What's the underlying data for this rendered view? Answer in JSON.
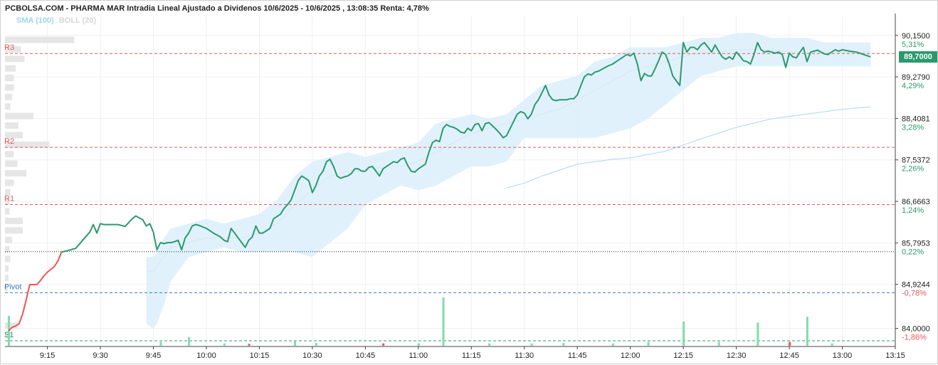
{
  "header": {
    "title": "PCBOLSA.COM - PHARMA MAR Intradia Lineal Ajustado a Dividenos 10/6/2025 - 10/6/2025 , 13:08:35 Renta: 4,78%",
    "legend_sma": "SMA (100)",
    "legend_boll": "BOLL (20)"
  },
  "last_price": "89,7000",
  "colors": {
    "up": "#2a9a6e",
    "down": "#ee5555",
    "band": "#ddeffb",
    "sma": "#a9d8f4",
    "pivot": "#3a78c8",
    "resistance": "#e05a5a",
    "support": "#2a9a6e",
    "volume_up": "#7fdcae"
  },
  "chart_data": {
    "type": "line",
    "ylim": [
      83.62,
      90.55
    ],
    "xlim": [
      "9:03",
      "13:15"
    ],
    "x_ticks": [
      "9:15",
      "9:30",
      "9:45",
      "10:00",
      "10:15",
      "10:30",
      "10:45",
      "11:00",
      "11:15",
      "11:30",
      "11:45",
      "12:00",
      "12:15",
      "12:30",
      "12:45",
      "13:00",
      "13:15"
    ],
    "y_ticks": [
      {
        "value": "90,1500",
        "pct": "5,31%"
      },
      {
        "value": "89,2790",
        "pct": "4,29%"
      },
      {
        "value": "88,4081",
        "pct": "3,28%"
      },
      {
        "value": "87,5372",
        "pct": "2,26%"
      },
      {
        "value": "86,6663",
        "pct": "1,24%"
      },
      {
        "value": "85,7953",
        "pct": "0,22%"
      },
      {
        "value": "84,9244",
        "pct": "-0,78%"
      },
      {
        "value": "84,0000",
        "pct": "-1,86%"
      }
    ],
    "reference_line": 85.61,
    "levels": [
      {
        "name": "R3",
        "value": 89.77
      },
      {
        "name": "R2",
        "value": 87.8
      },
      {
        "name": "R1",
        "value": 86.6
      },
      {
        "name": "Pivot",
        "value": 84.75
      },
      {
        "name": "S1",
        "value": 83.74
      }
    ],
    "price_red": [
      [
        "9:04",
        83.95
      ],
      [
        "9:05",
        84.02
      ],
      [
        "9:06",
        84.05
      ],
      [
        "9:07",
        84.1
      ],
      [
        "9:08",
        84.3
      ],
      [
        "9:09",
        84.6
      ],
      [
        "9:10",
        84.92
      ],
      [
        "9:11",
        84.92
      ],
      [
        "9:12",
        84.92
      ],
      [
        "9:13",
        85.0
      ],
      [
        "9:14",
        85.1
      ],
      [
        "9:15",
        85.18
      ],
      [
        "9:16",
        85.24
      ],
      [
        "9:17",
        85.3
      ],
      [
        "9:18",
        85.42
      ],
      [
        "9:19",
        85.6
      ]
    ],
    "price_green": [
      [
        "9:19",
        85.6
      ],
      [
        "9:21",
        85.64
      ],
      [
        "9:23",
        85.68
      ],
      [
        "9:25",
        85.85
      ],
      [
        "9:27",
        86.02
      ],
      [
        "9:28",
        86.18
      ],
      [
        "9:29",
        86.0
      ],
      [
        "9:30",
        86.2
      ],
      [
        "9:31",
        86.18
      ],
      [
        "9:33",
        86.18
      ],
      [
        "9:35",
        86.18
      ],
      [
        "9:37",
        86.14
      ],
      [
        "9:39",
        86.3
      ],
      [
        "9:40",
        86.36
      ],
      [
        "9:42",
        86.28
      ],
      [
        "9:43",
        86.15
      ],
      [
        "9:44",
        86.2
      ],
      [
        "9:45",
        86.02
      ],
      [
        "9:46",
        85.65
      ],
      [
        "9:47",
        85.8
      ],
      [
        "9:48",
        85.78
      ],
      [
        "9:49",
        85.8
      ],
      [
        "9:50",
        85.8
      ],
      [
        "9:51",
        85.82
      ],
      [
        "9:52",
        85.85
      ],
      [
        "9:53",
        85.65
      ],
      [
        "9:54",
        85.9
      ],
      [
        "9:55",
        86.0
      ],
      [
        "9:56",
        86.15
      ],
      [
        "9:57",
        86.18
      ],
      [
        "9:58",
        86.16
      ],
      [
        "10:00",
        86.1
      ],
      [
        "10:02",
        86.0
      ],
      [
        "10:04",
        85.92
      ],
      [
        "10:05",
        85.85
      ],
      [
        "10:06",
        85.82
      ],
      [
        "10:07",
        86.1
      ],
      [
        "10:08",
        86.0
      ],
      [
        "10:09",
        85.9
      ],
      [
        "10:10",
        85.8
      ],
      [
        "10:11",
        85.7
      ],
      [
        "10:12",
        85.85
      ],
      [
        "10:13",
        85.92
      ],
      [
        "10:14",
        86.15
      ],
      [
        "10:15",
        86.0
      ],
      [
        "10:16",
        86.0
      ],
      [
        "10:17",
        86.05
      ],
      [
        "10:18",
        86.1
      ],
      [
        "10:19",
        86.3
      ],
      [
        "10:20",
        86.35
      ],
      [
        "10:21",
        86.4
      ],
      [
        "10:22",
        86.52
      ],
      [
        "10:23",
        86.6
      ],
      [
        "10:24",
        86.7
      ],
      [
        "10:25",
        86.9
      ],
      [
        "10:26",
        87.1
      ],
      [
        "10:27",
        87.2
      ],
      [
        "10:28",
        87.15
      ],
      [
        "10:29",
        87.1
      ],
      [
        "10:30",
        86.85
      ],
      [
        "10:31",
        87.0
      ],
      [
        "10:32",
        87.2
      ],
      [
        "10:33",
        87.3
      ],
      [
        "10:34",
        87.5
      ],
      [
        "10:35",
        87.55
      ],
      [
        "10:36",
        87.4
      ],
      [
        "10:37",
        87.2
      ],
      [
        "10:38",
        87.15
      ],
      [
        "10:39",
        87.18
      ],
      [
        "10:40",
        87.2
      ],
      [
        "10:41",
        87.25
      ],
      [
        "10:42",
        87.35
      ],
      [
        "10:43",
        87.35
      ],
      [
        "10:44",
        87.3
      ],
      [
        "10:45",
        87.3
      ],
      [
        "10:46",
        87.38
      ],
      [
        "10:47",
        87.4
      ],
      [
        "10:48",
        87.3
      ],
      [
        "10:49",
        87.2
      ],
      [
        "10:50",
        87.35
      ],
      [
        "10:51",
        87.4
      ],
      [
        "10:52",
        87.45
      ],
      [
        "10:53",
        87.5
      ],
      [
        "10:54",
        87.48
      ],
      [
        "10:55",
        87.55
      ],
      [
        "10:56",
        87.58
      ],
      [
        "10:57",
        87.42
      ],
      [
        "10:58",
        87.3
      ],
      [
        "10:59",
        87.28
      ],
      [
        "11:00",
        87.35
      ],
      [
        "11:01",
        87.4
      ],
      [
        "11:02",
        87.45
      ],
      [
        "11:03",
        87.7
      ],
      [
        "11:04",
        87.9
      ],
      [
        "11:05",
        87.95
      ],
      [
        "11:06",
        87.92
      ],
      [
        "11:07",
        88.2
      ],
      [
        "11:08",
        88.28
      ],
      [
        "11:09",
        88.24
      ],
      [
        "11:10",
        88.22
      ],
      [
        "11:11",
        88.18
      ],
      [
        "11:12",
        88.12
      ],
      [
        "11:13",
        88.1
      ],
      [
        "11:14",
        88.2
      ],
      [
        "11:15",
        88.15
      ],
      [
        "11:16",
        88.28
      ],
      [
        "11:17",
        88.3
      ],
      [
        "11:18",
        88.15
      ],
      [
        "11:19",
        88.3
      ],
      [
        "11:20",
        88.32
      ],
      [
        "11:21",
        88.25
      ],
      [
        "11:22",
        88.18
      ],
      [
        "11:23",
        88.1
      ],
      [
        "11:24",
        88.0
      ],
      [
        "11:25",
        88.05
      ],
      [
        "11:26",
        88.2
      ],
      [
        "11:27",
        88.35
      ],
      [
        "11:28",
        88.5
      ],
      [
        "11:29",
        88.55
      ],
      [
        "11:30",
        88.52
      ],
      [
        "11:31",
        88.4
      ],
      [
        "11:32",
        88.5
      ],
      [
        "11:33",
        88.7
      ],
      [
        "11:34",
        88.8
      ],
      [
        "11:35",
        88.95
      ],
      [
        "11:36",
        89.1
      ],
      [
        "11:37",
        88.9
      ],
      [
        "11:38",
        88.8
      ],
      [
        "11:39",
        88.78
      ],
      [
        "11:40",
        88.8
      ],
      [
        "11:41",
        88.8
      ],
      [
        "11:42",
        88.8
      ],
      [
        "11:43",
        88.82
      ],
      [
        "11:44",
        88.82
      ],
      [
        "11:45",
        88.9
      ],
      [
        "11:46",
        89.1
      ],
      [
        "11:47",
        89.28
      ],
      [
        "11:48",
        89.34
      ],
      [
        "11:49",
        89.32
      ],
      [
        "11:50",
        89.38
      ],
      [
        "11:51",
        89.4
      ],
      [
        "11:52",
        89.44
      ],
      [
        "11:53",
        89.48
      ],
      [
        "11:54",
        89.52
      ],
      [
        "11:55",
        89.55
      ],
      [
        "11:56",
        89.6
      ],
      [
        "11:57",
        89.65
      ],
      [
        "11:58",
        89.7
      ],
      [
        "11:59",
        89.75
      ],
      [
        "12:00",
        89.72
      ],
      [
        "12:01",
        89.78
      ],
      [
        "12:02",
        89.55
      ],
      [
        "12:03",
        89.2
      ],
      [
        "12:04",
        89.35
      ],
      [
        "12:05",
        89.3
      ],
      [
        "12:06",
        89.3
      ],
      [
        "12:07",
        89.45
      ],
      [
        "12:08",
        89.62
      ],
      [
        "12:09",
        89.8
      ],
      [
        "12:10",
        89.75
      ],
      [
        "12:11",
        89.55
      ],
      [
        "12:12",
        89.3
      ],
      [
        "12:13",
        89.2
      ],
      [
        "12:14",
        89.1
      ],
      [
        "12:15",
        90.0
      ],
      [
        "12:16",
        89.8
      ],
      [
        "12:17",
        89.9
      ],
      [
        "12:18",
        89.9
      ],
      [
        "12:19",
        89.85
      ],
      [
        "12:20",
        89.95
      ],
      [
        "12:21",
        90.0
      ],
      [
        "12:22",
        89.9
      ],
      [
        "12:23",
        89.8
      ],
      [
        "12:24",
        89.95
      ],
      [
        "12:25",
        89.82
      ],
      [
        "12:26",
        89.7
      ],
      [
        "12:27",
        89.65
      ],
      [
        "12:28",
        89.7
      ],
      [
        "12:29",
        89.65
      ],
      [
        "12:30",
        89.8
      ],
      [
        "12:31",
        89.72
      ],
      [
        "12:32",
        89.62
      ],
      [
        "12:33",
        89.6
      ],
      [
        "12:34",
        89.55
      ],
      [
        "12:35",
        89.75
      ],
      [
        "12:36",
        90.0
      ],
      [
        "12:37",
        89.85
      ],
      [
        "12:38",
        89.8
      ],
      [
        "12:39",
        89.82
      ],
      [
        "12:40",
        89.8
      ],
      [
        "12:41",
        89.78
      ],
      [
        "12:42",
        89.8
      ],
      [
        "12:43",
        89.75
      ],
      [
        "12:44",
        89.48
      ],
      [
        "12:45",
        89.78
      ],
      [
        "12:46",
        89.7
      ],
      [
        "12:47",
        89.68
      ],
      [
        "12:48",
        89.8
      ],
      [
        "12:49",
        89.9
      ],
      [
        "12:50",
        89.6
      ],
      [
        "12:51",
        89.8
      ],
      [
        "12:52",
        89.82
      ],
      [
        "12:53",
        89.84
      ],
      [
        "12:54",
        89.8
      ],
      [
        "12:55",
        89.76
      ],
      [
        "12:56",
        89.75
      ],
      [
        "12:57",
        89.8
      ],
      [
        "12:58",
        89.85
      ],
      [
        "12:59",
        89.82
      ],
      [
        "13:00",
        89.85
      ],
      [
        "13:02",
        89.82
      ],
      [
        "13:04",
        89.8
      ],
      [
        "13:06",
        89.75
      ],
      [
        "13:08",
        89.7
      ]
    ],
    "bollinger": {
      "x": [
        "9:43",
        "9:45",
        "9:46",
        "9:48",
        "9:50",
        "9:55",
        "10:00",
        "10:05",
        "10:10",
        "10:15",
        "10:20",
        "10:25",
        "10:30",
        "10:35",
        "10:40",
        "10:45",
        "10:50",
        "10:55",
        "11:00",
        "11:05",
        "11:10",
        "11:15",
        "11:20",
        "11:25",
        "11:30",
        "11:35",
        "11:40",
        "11:45",
        "11:50",
        "11:55",
        "12:00",
        "12:05",
        "12:10",
        "12:15",
        "12:20",
        "12:25",
        "12:30",
        "12:35",
        "12:40",
        "12:45",
        "12:50",
        "12:55",
        "13:00",
        "13:05",
        "13:08"
      ],
      "upper": [
        85.5,
        85.5,
        85.6,
        85.9,
        86.1,
        86.2,
        86.3,
        86.2,
        86.3,
        86.4,
        86.7,
        87.2,
        87.5,
        87.6,
        87.7,
        87.6,
        87.7,
        87.8,
        87.9,
        88.3,
        88.4,
        88.5,
        88.4,
        88.5,
        88.8,
        89.1,
        89.2,
        89.3,
        89.6,
        89.7,
        89.9,
        89.9,
        89.9,
        90.0,
        90.1,
        90.1,
        90.2,
        90.2,
        90.1,
        90.1,
        90.1,
        90.0,
        90.0,
        90.0,
        90.0
      ],
      "middle": [
        85.2,
        85.2,
        85.3,
        85.5,
        85.7,
        85.8,
        85.9,
        85.9,
        85.9,
        86.0,
        86.2,
        86.6,
        86.9,
        87.2,
        87.3,
        87.3,
        87.4,
        87.4,
        87.5,
        87.7,
        87.9,
        88.1,
        88.2,
        88.3,
        88.4,
        88.5,
        88.6,
        88.8,
        89.0,
        89.2,
        89.4,
        89.5,
        89.6,
        89.7,
        89.8,
        89.8,
        89.85,
        89.85,
        89.85,
        89.8,
        89.8,
        89.8,
        89.8,
        89.8,
        89.8
      ],
      "lower": [
        84.1,
        84.0,
        84.1,
        84.5,
        85.0,
        85.5,
        85.6,
        85.7,
        85.6,
        85.6,
        85.6,
        85.6,
        85.5,
        85.8,
        86.1,
        86.6,
        86.8,
        87.0,
        86.9,
        87.0,
        87.2,
        87.4,
        87.4,
        87.5,
        88.0,
        88.0,
        88.0,
        88.0,
        88.0,
        88.1,
        88.2,
        88.4,
        88.7,
        89.0,
        89.3,
        89.4,
        89.5,
        89.5,
        89.5,
        89.5,
        89.5,
        89.5,
        89.5,
        89.5,
        89.5
      ]
    },
    "sma": {
      "x": [
        "11:25",
        "11:30",
        "11:35",
        "11:45",
        "11:55",
        "12:00",
        "12:10",
        "12:15",
        "12:20",
        "12:25",
        "12:30",
        "12:40",
        "12:50",
        "13:00",
        "13:08"
      ],
      "values": [
        86.95,
        87.05,
        87.2,
        87.45,
        87.55,
        87.58,
        87.72,
        87.85,
        87.98,
        88.1,
        88.22,
        88.4,
        88.5,
        88.6,
        88.65
      ]
    },
    "volume": {
      "max": 1.0,
      "bars": [
        {
          "t": "9:04",
          "v": 0.62,
          "dir": "up"
        },
        {
          "t": "9:47",
          "v": 0.08,
          "dir": "up"
        },
        {
          "t": "9:55",
          "v": 0.18,
          "dir": "up"
        },
        {
          "t": "10:05",
          "v": 0.05,
          "dir": "up"
        },
        {
          "t": "10:12",
          "v": 0.04,
          "dir": "down"
        },
        {
          "t": "10:25",
          "v": 0.1,
          "dir": "up"
        },
        {
          "t": "10:31",
          "v": 0.06,
          "dir": "up"
        },
        {
          "t": "10:50",
          "v": 0.05,
          "dir": "down"
        },
        {
          "t": "11:00",
          "v": 0.05,
          "dir": "up"
        },
        {
          "t": "11:07",
          "v": 1.0,
          "dir": "up"
        },
        {
          "t": "11:20",
          "v": 0.05,
          "dir": "up"
        },
        {
          "t": "11:32",
          "v": 0.05,
          "dir": "up"
        },
        {
          "t": "11:41",
          "v": 0.06,
          "dir": "up"
        },
        {
          "t": "11:55",
          "v": 0.05,
          "dir": "up"
        },
        {
          "t": "12:05",
          "v": 0.08,
          "dir": "up"
        },
        {
          "t": "12:15",
          "v": 0.5,
          "dir": "up"
        },
        {
          "t": "12:25",
          "v": 0.08,
          "dir": "up"
        },
        {
          "t": "12:36",
          "v": 0.48,
          "dir": "up"
        },
        {
          "t": "12:45",
          "v": 0.08,
          "dir": "down"
        },
        {
          "t": "12:50",
          "v": 0.6,
          "dir": "up"
        },
        {
          "t": "12:57",
          "v": 0.05,
          "dir": "up"
        }
      ]
    },
    "volume_profile": [
      {
        "price": 90.05,
        "w": 0.78
      },
      {
        "price": 89.85,
        "w": 0.18
      },
      {
        "price": 89.65,
        "w": 0.22
      },
      {
        "price": 89.45,
        "w": 0.12
      },
      {
        "price": 89.25,
        "w": 0.1
      },
      {
        "price": 89.05,
        "w": 0.1
      },
      {
        "price": 88.85,
        "w": 0.08
      },
      {
        "price": 88.65,
        "w": 0.06
      },
      {
        "price": 88.45,
        "w": 0.32
      },
      {
        "price": 88.25,
        "w": 0.15
      },
      {
        "price": 88.05,
        "w": 0.2
      },
      {
        "price": 87.85,
        "w": 0.5
      },
      {
        "price": 87.65,
        "w": 0.1
      },
      {
        "price": 87.45,
        "w": 0.14
      },
      {
        "price": 87.25,
        "w": 0.24
      },
      {
        "price": 87.05,
        "w": 0.1
      },
      {
        "price": 86.85,
        "w": 0.06
      },
      {
        "price": 86.65,
        "w": 0.05
      },
      {
        "price": 86.45,
        "w": 0.05
      },
      {
        "price": 86.25,
        "w": 0.2
      },
      {
        "price": 86.05,
        "w": 0.2
      },
      {
        "price": 85.85,
        "w": 0.08
      },
      {
        "price": 85.65,
        "w": 0.05
      },
      {
        "price": 85.45,
        "w": 0.06
      },
      {
        "price": 85.25,
        "w": 0.04
      },
      {
        "price": 85.05,
        "w": 0.04
      },
      {
        "price": 84.85,
        "w": 0.03
      },
      {
        "price": 84.05,
        "w": 0.15
      },
      {
        "price": 83.85,
        "w": 0.06
      }
    ]
  }
}
